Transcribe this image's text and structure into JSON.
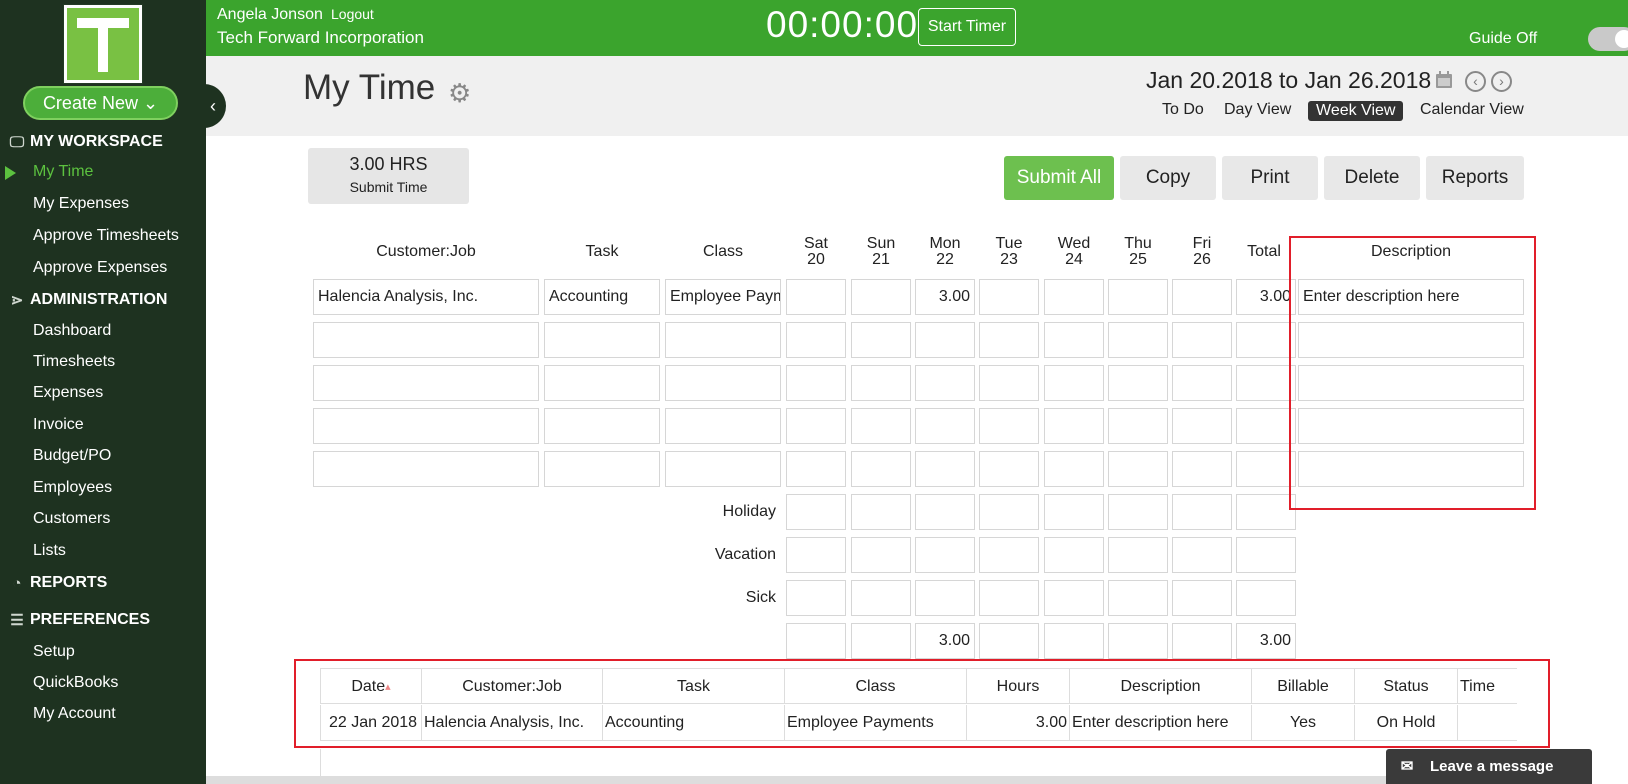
{
  "sidebar": {
    "create_new": "Create New ⌄",
    "sections": [
      {
        "label": "MY WORKSPACE",
        "icon": "monitor-icon"
      },
      {
        "label": "ADMINISTRATION",
        "icon": "share-icon"
      },
      {
        "label": "REPORTS",
        "icon": "pie-icon"
      },
      {
        "label": "PREFERENCES",
        "icon": "sliders-icon"
      }
    ],
    "items": {
      "my_time": "My Time",
      "my_expenses": "My Expenses",
      "approve_timesheets": "Approve Timesheets",
      "approve_expenses": "Approve Expenses",
      "dashboard": "Dashboard",
      "timesheets": "Timesheets",
      "expenses": "Expenses",
      "invoice": "Invoice",
      "budget_po": "Budget/PO",
      "employees": "Employees",
      "customers": "Customers",
      "lists": "Lists",
      "setup": "Setup",
      "quickbooks": "QuickBooks",
      "my_account": "My Account"
    },
    "logo_letter": "T"
  },
  "topbar": {
    "user": "Angela Jonson",
    "logout": "Logout",
    "company": "Tech Forward Incorporation",
    "timer": "00:00:00",
    "start_timer": "Start Timer",
    "guide": "Guide Off"
  },
  "header": {
    "title": "My Time",
    "date_range": "Jan 20.2018 to Jan 26.2018",
    "views": {
      "todo": "To Do",
      "day": "Day View",
      "week": "Week View",
      "calendar": "Calendar View"
    },
    "active_view": "Week View"
  },
  "summary": {
    "hours": "3.00 HRS",
    "submit": "Submit Time"
  },
  "actions": {
    "submit_all": "Submit All",
    "copy": "Copy",
    "print": "Print",
    "delete": "Delete",
    "reports": "Reports"
  },
  "grid": {
    "headers": {
      "customer_job": "Customer:Job",
      "task": "Task",
      "class": "Class",
      "sat": [
        "Sat",
        "20"
      ],
      "sun": [
        "Sun",
        "21"
      ],
      "mon": [
        "Mon",
        "22"
      ],
      "tue": [
        "Tue",
        "23"
      ],
      "wed": [
        "Wed",
        "24"
      ],
      "thu": [
        "Thu",
        "25"
      ],
      "fri": [
        "Fri",
        "26"
      ],
      "total": "Total",
      "description": "Description"
    },
    "row1": {
      "customer_job": "Halencia Analysis, Inc.",
      "task": "Accounting",
      "class": "Employee Payments",
      "mon": "3.00",
      "total": "3.00",
      "description_placeholder": "Enter description here"
    },
    "labels": {
      "holiday": "Holiday",
      "vacation": "Vacation",
      "sick": "Sick"
    },
    "totals": {
      "mon": "3.00",
      "total": "3.00"
    }
  },
  "bottom_table": {
    "headers": [
      "Date",
      "Customer:Job",
      "Task",
      "Class",
      "Hours",
      "Description",
      "Billable",
      "Status",
      "Time"
    ],
    "rows": [
      [
        "22 Jan 2018",
        "Halencia Analysis, Inc.",
        "Accounting",
        "Employee Payments",
        "3.00",
        "Enter description here",
        "Yes",
        "On Hold",
        ""
      ]
    ]
  },
  "chat": {
    "label": "Leave a message"
  },
  "colors": {
    "brand_green": "#3ba42d",
    "sidebar": "#1e3220",
    "active": "#5cc23f",
    "highlight_frame": "#e11e2a"
  }
}
